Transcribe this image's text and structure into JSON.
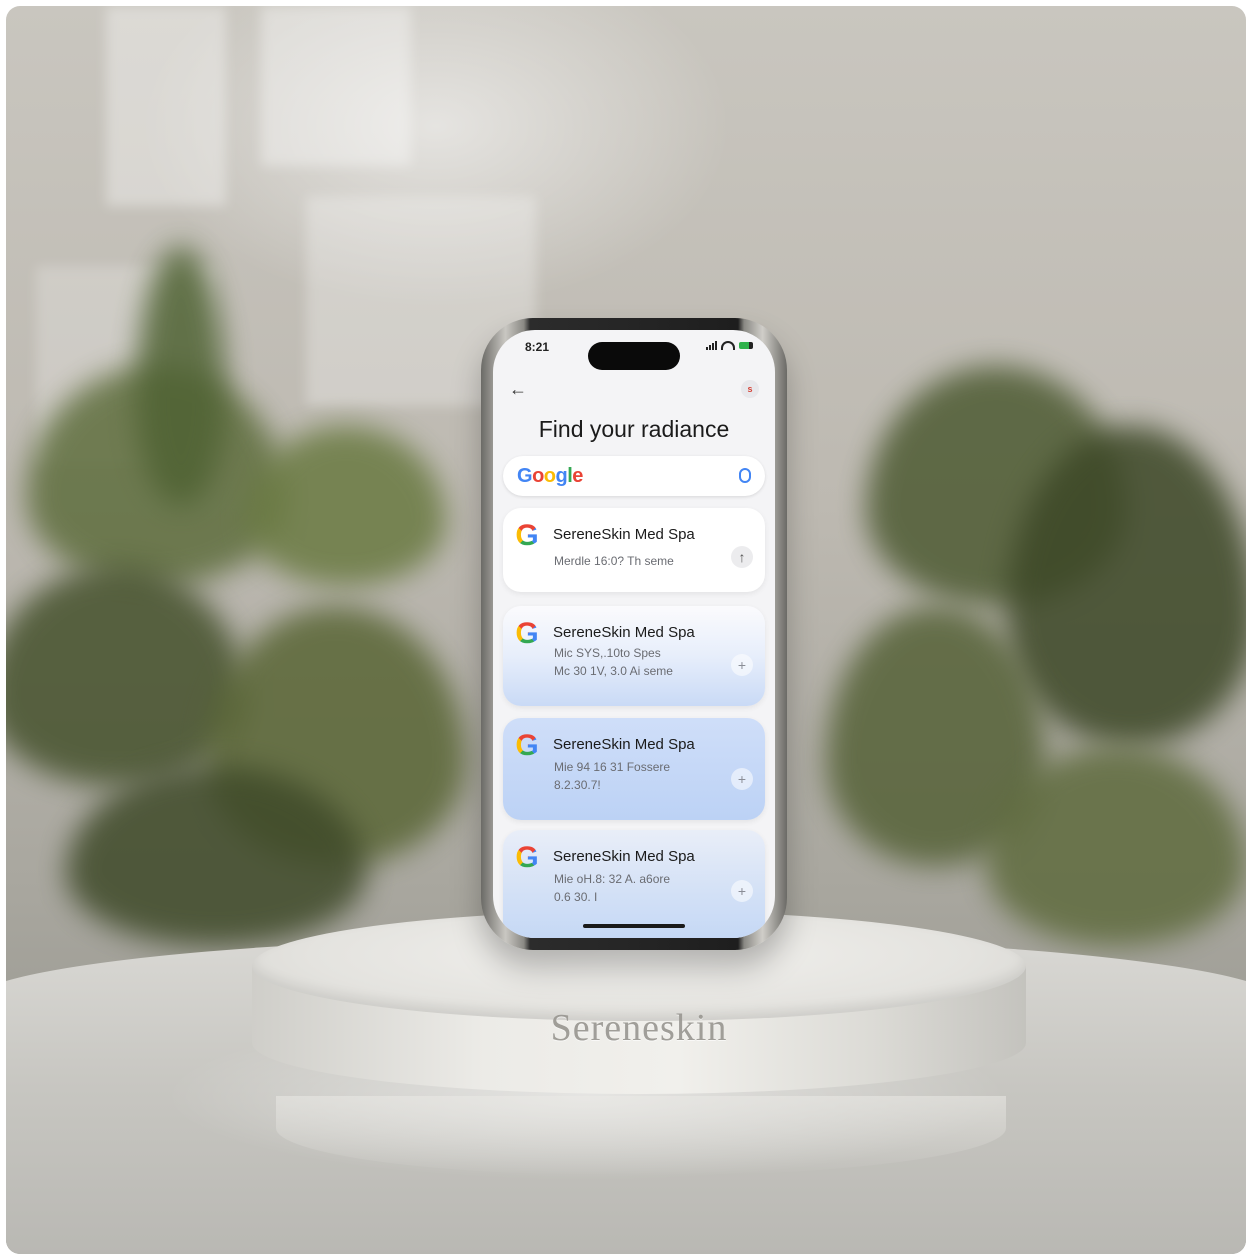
{
  "status_bar": {
    "time": "8:21"
  },
  "header": {
    "back_glyph": "←",
    "avatar_glyph": "s",
    "title": "Find your radiance"
  },
  "search": {
    "logo_text": "Google",
    "logo_colors": [
      "#4285f4",
      "#ea4335",
      "#fbbc05",
      "#4285f4",
      "#34a853",
      "#ea4335"
    ]
  },
  "results": [
    {
      "name": "SereneSkin Med Spa",
      "meta": "Merdle 16:0? Th seme",
      "action_glyph": "↑"
    },
    {
      "name": "SereneSkin Med Spa",
      "meta": "Mic SYS,.10to Spes\nMc 30 1V, 3.0 Ai seme",
      "action_glyph": "+"
    },
    {
      "name": "SereneSkin Med Spa",
      "meta": "Mie 94 16 31 Fossere\n8.2.30.7!",
      "action_glyph": "+"
    },
    {
      "name": "SereneSkin Med Spa",
      "meta": "Mie oH.8: 32 A. a6ore\n0.6 30. I",
      "action_glyph": "+"
    }
  ],
  "pedestal": {
    "brand": "Sereneskin"
  },
  "icons": [
    "back-arrow-icon",
    "avatar-icon",
    "mic-icon",
    "google-g-icon",
    "plus-icon",
    "arrow-up-icon",
    "signal-icon",
    "wifi-icon",
    "battery-icon"
  ]
}
